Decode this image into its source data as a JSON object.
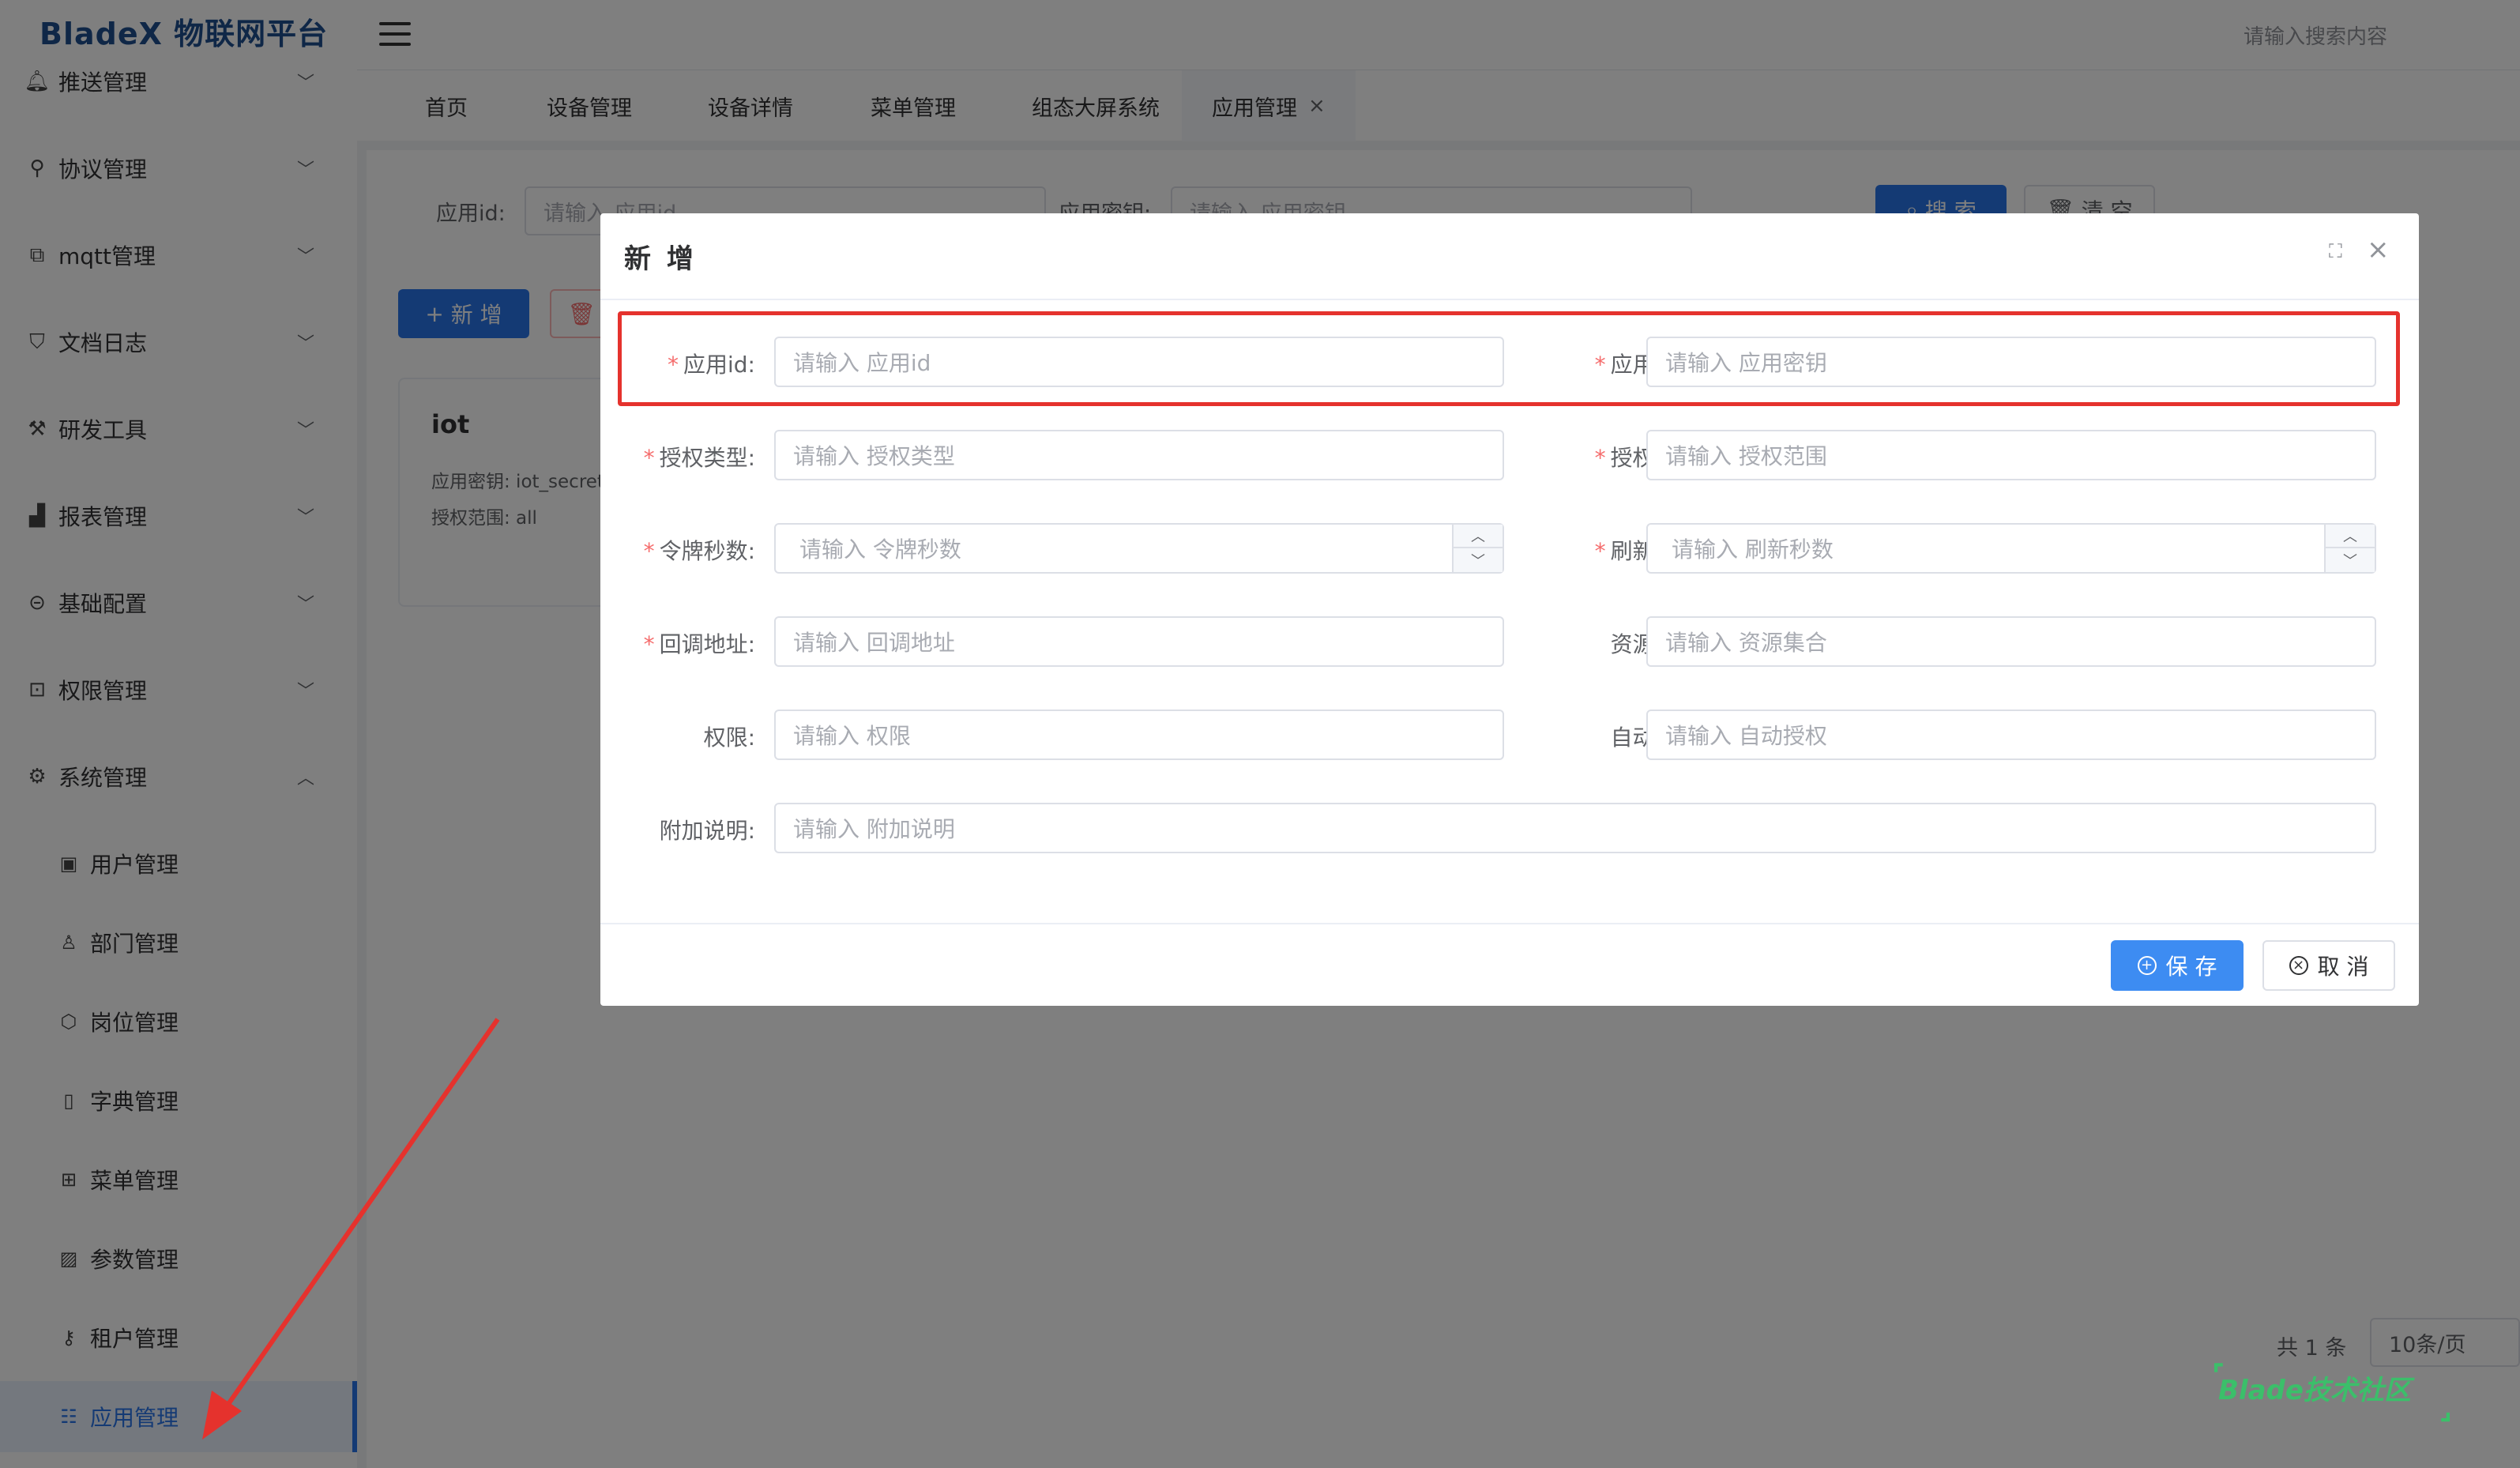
{
  "app": {
    "logo": "BladeX 物联网平台",
    "search_placeholder": "请输入搜索内容"
  },
  "sidebar": {
    "menus": [
      {
        "label": "推送管理",
        "icon": "bell-icon",
        "arrow": "﹀"
      },
      {
        "label": "协议管理",
        "icon": "protocol-icon",
        "arrow": "﹀"
      },
      {
        "label": "mqtt管理",
        "icon": "mqtt-icon",
        "arrow": "﹀"
      },
      {
        "label": "文档日志",
        "icon": "shield-icon",
        "arrow": "﹀"
      },
      {
        "label": "研发工具",
        "icon": "wrench-icon",
        "arrow": "﹀"
      },
      {
        "label": "报表管理",
        "icon": "bar-chart-icon",
        "arrow": "﹀"
      },
      {
        "label": "基础配置",
        "icon": "link-icon",
        "arrow": "﹀"
      },
      {
        "label": "权限管理",
        "icon": "lock-icon",
        "arrow": "﹀"
      },
      {
        "label": "系统管理",
        "icon": "gear-icon",
        "arrow": "︿"
      }
    ],
    "sub_items": [
      {
        "label": "用户管理",
        "icon": "user-card-icon"
      },
      {
        "label": "部门管理",
        "icon": "user-icon"
      },
      {
        "label": "岗位管理",
        "icon": "cube-icon"
      },
      {
        "label": "字典管理",
        "icon": "book-icon"
      },
      {
        "label": "菜单管理",
        "icon": "tree-icon"
      },
      {
        "label": "参数管理",
        "icon": "image-icon"
      },
      {
        "label": "租户管理",
        "icon": "key-icon"
      },
      {
        "label": "应用管理",
        "icon": "app-icon"
      }
    ]
  },
  "tabs": [
    {
      "label": "首页"
    },
    {
      "label": "设备管理"
    },
    {
      "label": "设备详情"
    },
    {
      "label": "菜单管理"
    },
    {
      "label": "组态大屏系统"
    },
    {
      "label": "应用管理",
      "close": "×"
    }
  ],
  "search_bar": {
    "app_id_label": "应用id:",
    "app_id_placeholder": "请输入 应用id",
    "secret_label": "应用密钥:",
    "secret_placeholder": "请输入 应用密钥",
    "search_button": "搜 索",
    "clear_button": "清 空"
  },
  "toolbar": {
    "add_button": "新 增"
  },
  "card": {
    "title": "iot",
    "secret_line": "应用密钥:  iot_secret",
    "scope_line": "授权范围:  all"
  },
  "pagination": {
    "total": "共 1 条",
    "page_size": "10条/页"
  },
  "watermark": "Blade技术社区",
  "dialog": {
    "title": "新 增",
    "fields": {
      "app_id": {
        "label": "应用id:",
        "placeholder": "请输入 应用id",
        "required": true
      },
      "app_secret": {
        "label": "应用密钥:",
        "placeholder": "请输入 应用密钥",
        "required": true
      },
      "grant_type": {
        "label": "授权类型:",
        "placeholder": "请输入 授权类型",
        "required": true
      },
      "scope": {
        "label": "授权范围:",
        "placeholder": "请输入 授权范围",
        "required": true
      },
      "token_seconds": {
        "label": "令牌秒数:",
        "placeholder": "请输入 令牌秒数",
        "required": true
      },
      "refresh_seconds": {
        "label": "刷新秒数:",
        "placeholder": "请输入 刷新秒数",
        "required": true
      },
      "callback_url": {
        "label": "回调地址:",
        "placeholder": "请输入 回调地址",
        "required": true
      },
      "resources": {
        "label": "资源集合:",
        "placeholder": "请输入 资源集合",
        "required": false
      },
      "authorities": {
        "label": "权限:",
        "placeholder": "请输入 权限",
        "required": false
      },
      "auto_approve": {
        "label": "自动授权:",
        "placeholder": "请输入 自动授权",
        "required": false
      },
      "additional": {
        "label": "附加说明:",
        "placeholder": "请输入 附加说明",
        "required": false
      }
    },
    "save_button": "保 存",
    "cancel_button": "取 消",
    "required_mark": "*"
  },
  "colors": {
    "primary": "#2874e8",
    "save_button": "#3d8cf2",
    "highlight": "#e5322d",
    "required": "#f56c6c",
    "watermark": "#3bbf6a"
  }
}
